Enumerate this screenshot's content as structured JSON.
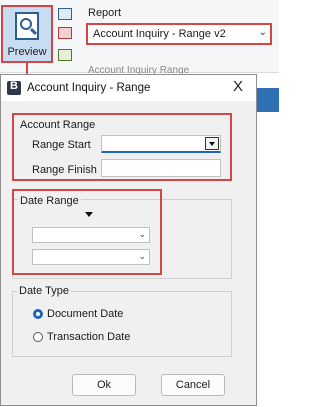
{
  "ribbon": {
    "preview_label": "Preview",
    "report_label": "Report",
    "report_value": "Account Inquiry - Range v2",
    "ghost_text": "Account Inquiry Range"
  },
  "dialog": {
    "title": "Account Inquiry - Range",
    "close": "X",
    "account_range": {
      "title": "Account Range",
      "start_label": "Range Start",
      "finish_label": "Range Finish",
      "start_value": "",
      "finish_value": ""
    },
    "date_range": {
      "title": "Date Range",
      "from_value": "",
      "to_value": ""
    },
    "date_type": {
      "title": "Date Type",
      "options": [
        "Document Date",
        "Transaction Date"
      ],
      "selected": "Document Date"
    },
    "buttons": {
      "ok": "Ok",
      "cancel": "Cancel"
    }
  },
  "colors": {
    "highlight": "#d64545",
    "accent": "#2f6fb3",
    "selected_radio": "#1f65b8"
  }
}
